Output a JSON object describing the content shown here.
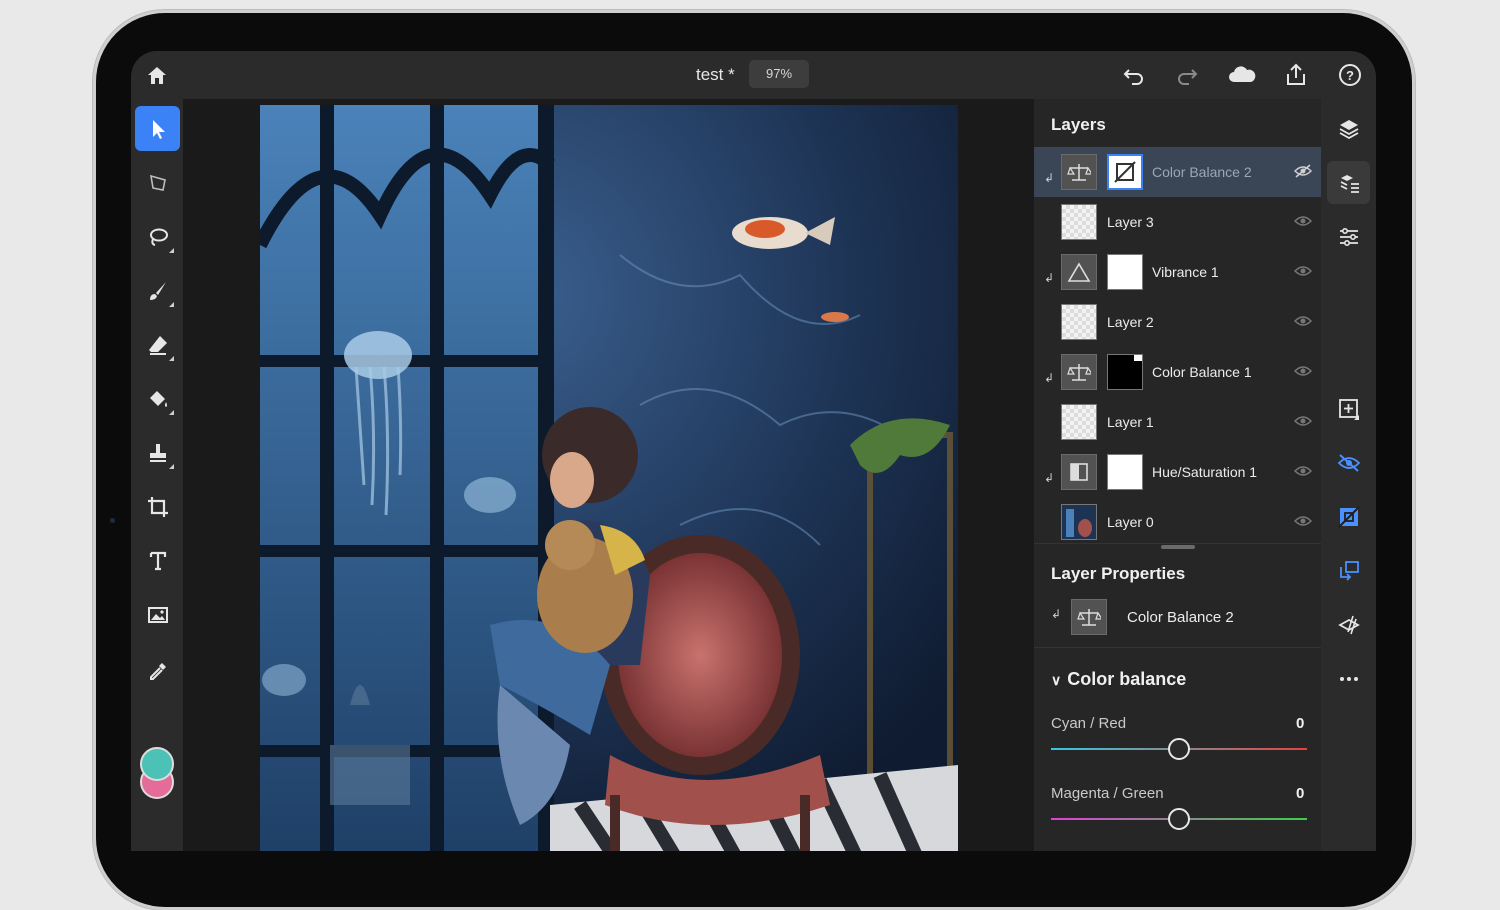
{
  "colors": {
    "accent": "#3b82f6",
    "blue_icon": "#4a90ff",
    "foreground_color": "#4cc2b6",
    "background_color": "#e56b98"
  },
  "topbar": {
    "title": "test *",
    "zoom": "97%",
    "icons": [
      "home-icon",
      "undo-icon",
      "redo-icon",
      "cloud-icon",
      "share-icon",
      "help-icon"
    ]
  },
  "toolbar": {
    "tools": [
      "select-tool",
      "transform-tool",
      "lasso-tool",
      "brush-tool",
      "eraser-tool",
      "fill-tool",
      "stamp-tool",
      "crop-tool",
      "type-tool",
      "place-image-tool",
      "eyedropper-tool"
    ],
    "active_tool": "select-tool"
  },
  "layers_panel": {
    "title": "Layers",
    "layers": [
      {
        "name": "Color Balance 2",
        "type": "adjustment",
        "icon": "balance-icon",
        "selected": true,
        "visible": false,
        "clipped": true
      },
      {
        "name": "Layer 3",
        "type": "pixel",
        "visible": true
      },
      {
        "name": "Vibrance 1",
        "type": "adjustment",
        "icon": "triangle-icon",
        "visible": true,
        "clipped": true
      },
      {
        "name": "Layer 2",
        "type": "pixel",
        "visible": true
      },
      {
        "name": "Color Balance 1",
        "type": "adjustment",
        "icon": "balance-icon",
        "visible": true,
        "clipped": true
      },
      {
        "name": "Layer 1",
        "type": "pixel",
        "visible": true
      },
      {
        "name": "Hue/Saturation 1",
        "type": "adjustment",
        "icon": "huesat-icon",
        "visible": true,
        "clipped": true
      },
      {
        "name": "Layer 0",
        "type": "image",
        "visible": true
      }
    ]
  },
  "layer_properties": {
    "title": "Layer Properties",
    "layer_name": "Color Balance 2",
    "section": "Color balance",
    "sliders": [
      {
        "label": "Cyan / Red",
        "value": "0",
        "left_color": "#33c9e6",
        "right_color": "#e84040"
      },
      {
        "label": "Magenta / Green",
        "value": "0",
        "left_color": "#e040d8",
        "right_color": "#3ccf4a"
      }
    ]
  },
  "right_strip": {
    "buttons": [
      "layers-icon",
      "layer-list-icon",
      "adjustments-icon",
      "add-layer-icon",
      "visibility-icon",
      "mask-icon",
      "clip-icon",
      "fx-icon",
      "more-icon"
    ]
  }
}
